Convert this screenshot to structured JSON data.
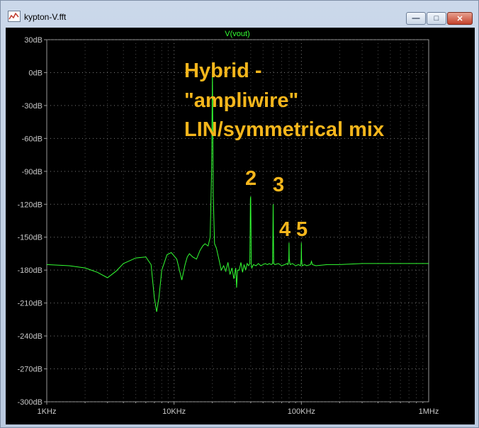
{
  "window": {
    "title": "kypton-V.fft"
  },
  "chart_data": {
    "type": "line",
    "title": "V(vout)",
    "x_scale": "log",
    "xlim": [
      1000,
      1000000
    ],
    "ylim": [
      -300,
      30
    ],
    "y_ticks": [
      30,
      0,
      -30,
      -60,
      -90,
      -120,
      -150,
      -180,
      -210,
      -240,
      -270,
      -300
    ],
    "y_tick_labels": [
      "30dB",
      "0dB",
      "-30dB",
      "-60dB",
      "-90dB",
      "-120dB",
      "-150dB",
      "-180dB",
      "-210dB",
      "-240dB",
      "-270dB",
      "-300dB"
    ],
    "x_ticks": [
      1000,
      10000,
      100000,
      1000000
    ],
    "x_tick_labels": [
      "1KHz",
      "10KHz",
      "100KHz",
      "1MHz"
    ],
    "series_color": "#33ff33",
    "series": [
      {
        "x": [
          1000,
          1500,
          2000,
          2500,
          3000,
          3500,
          4000,
          5000,
          6000,
          6600,
          7000,
          7300,
          7600,
          8000,
          8800,
          9500,
          10500,
          11500,
          12200,
          12700,
          13200,
          14000,
          15000,
          16000,
          16800,
          17500,
          18500,
          19200,
          19700,
          19900,
          20000,
          20100,
          20300,
          20800,
          21500,
          22500,
          23500,
          24500,
          25500,
          26500,
          27500,
          28500,
          29500,
          30500,
          31000,
          31500,
          32500,
          33500,
          34500,
          35500,
          36500,
          37500,
          38500,
          39300,
          39600,
          39800,
          40000,
          40200,
          40400,
          40800,
          42000,
          44000,
          46000,
          48000,
          50000,
          52000,
          54000,
          56000,
          58000,
          59400,
          59700,
          60000,
          60300,
          60600,
          62000,
          66000,
          70000,
          74000,
          77000,
          78500,
          79700,
          80000,
          80300,
          81500,
          85000,
          90000,
          95000,
          98500,
          99700,
          100000,
          100300,
          101500,
          106000,
          110000,
          118000,
          120000,
          122000,
          130000,
          160000,
          200000,
          300000,
          500000,
          700000,
          1000000
        ],
        "y": [
          -175,
          -176,
          -178,
          -182,
          -187,
          -181,
          -174,
          -169,
          -168,
          -175,
          -205,
          -218,
          -205,
          -180,
          -166,
          -164,
          -170,
          -189,
          -175,
          -168,
          -165,
          -168,
          -170,
          -162,
          -158,
          -156,
          -158,
          -150,
          -90,
          -30,
          2,
          -30,
          -110,
          -156,
          -160,
          -170,
          -180,
          -176,
          -181,
          -173,
          -184,
          -178,
          -188,
          -178,
          -196,
          -180,
          -180,
          -173,
          -182,
          -175,
          -180,
          -174,
          -176,
          -174,
          -140,
          -115,
          -113,
          -140,
          -175,
          -178,
          -175,
          -176,
          -174,
          -176,
          -175,
          -174,
          -175,
          -174,
          -175,
          -174,
          -150,
          -120,
          -150,
          -174,
          -175,
          -174,
          -176,
          -175,
          -174,
          -175,
          -170,
          -155,
          -170,
          -175,
          -174,
          -176,
          -175,
          -176,
          -170,
          -155,
          -170,
          -176,
          -175,
          -176,
          -175,
          -172,
          -175,
          -176,
          -175,
          -175,
          -174,
          -174,
          -174,
          -174
        ]
      }
    ]
  },
  "annotations": {
    "line1": "Hybrid -",
    "line2": "\"ampliwire\"",
    "line3": "LIN/symmetrical mix",
    "h2": "2",
    "h3": "3",
    "h4": "4",
    "h5": "5",
    "color": "#f5b61c"
  }
}
